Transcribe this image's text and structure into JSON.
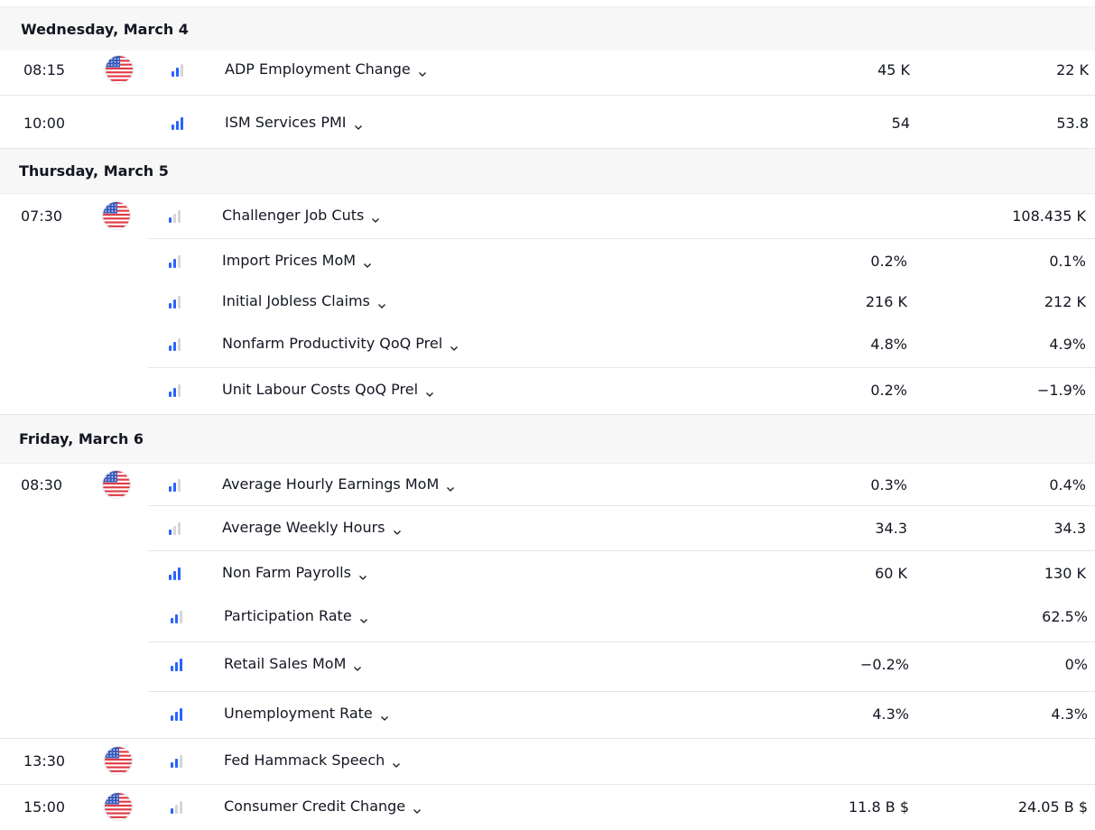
{
  "days": [
    {
      "label": "Wednesday, March 4"
    },
    {
      "label": "Thursday, March 5"
    },
    {
      "label": "Friday, March 6"
    }
  ],
  "events": [
    {
      "time": "08:15",
      "flag": "us-flag-icon",
      "importance": 2,
      "name": "ADP Employment Change",
      "actual": "45 K",
      "forecast": "22 K"
    },
    {
      "time": "10:00",
      "importance": 3,
      "name": "ISM Services PMI",
      "actual": "54",
      "forecast": "53.8"
    },
    {
      "time": "07:30",
      "flag": "us-flag-icon",
      "importance": 1,
      "name": "Challenger Job Cuts",
      "actual": "",
      "forecast": "108.435 K"
    },
    {
      "time": "",
      "importance": 2,
      "name": "Import Prices MoM",
      "actual": "0.2%",
      "forecast": "0.1%"
    },
    {
      "time": "",
      "importance": 2,
      "name": "Initial Jobless Claims",
      "actual": "216 K",
      "forecast": "212 K"
    },
    {
      "time": "",
      "importance": 2,
      "name": "Nonfarm Productivity QoQ Prel",
      "actual": "4.8%",
      "forecast": "4.9%"
    },
    {
      "time": "",
      "importance": 2,
      "name": "Unit Labour Costs QoQ Prel",
      "actual": "0.2%",
      "forecast": "−1.9%"
    },
    {
      "time": "08:30",
      "flag": "us-flag-icon",
      "importance": 2,
      "name": "Average Hourly Earnings MoM",
      "actual": "0.3%",
      "forecast": "0.4%"
    },
    {
      "time": "",
      "importance": 1,
      "name": "Average Weekly Hours",
      "actual": "34.3",
      "forecast": "34.3"
    },
    {
      "time": "",
      "importance": 3,
      "name": "Non Farm Payrolls",
      "actual": "60 K",
      "forecast": "130 K"
    },
    {
      "time": "",
      "importance": 2,
      "name": "Participation Rate",
      "actual": "",
      "forecast": "62.5%"
    },
    {
      "time": "",
      "importance": 3,
      "name": "Retail Sales MoM",
      "actual": "−0.2%",
      "forecast": "0%"
    },
    {
      "time": "",
      "importance": 3,
      "name": "Unemployment Rate",
      "actual": "4.3%",
      "forecast": "4.3%"
    },
    {
      "time": "13:30",
      "flag": "us-flag-icon",
      "importance": 2,
      "name": "Fed Hammack Speech",
      "actual": "",
      "forecast": ""
    },
    {
      "time": "15:00",
      "flag": "us-flag-icon",
      "importance": 1,
      "name": "Consumer Credit Change",
      "actual": "11.8 B $",
      "forecast": "24.05 B $"
    }
  ],
  "colors": {
    "accent": "#2962ff",
    "inactive_bar": "#d6d6d6",
    "header_bg": "#f7f7f7",
    "divider": "#e6e6e6"
  }
}
